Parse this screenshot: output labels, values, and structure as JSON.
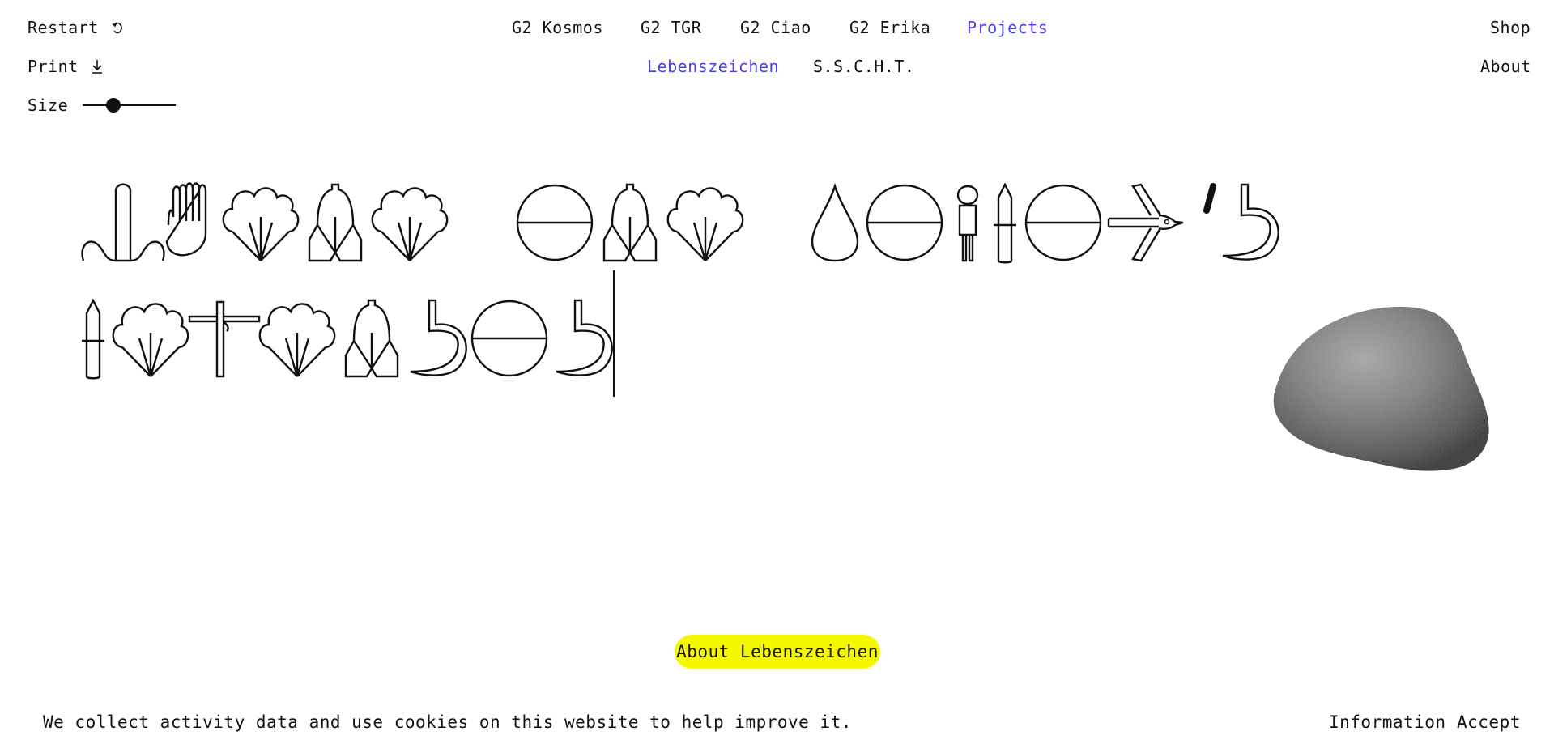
{
  "nav": {
    "restart_label": "Restart",
    "restart_icon": "restart-icon",
    "print_label": "Print",
    "print_icon": "download-arrow-icon",
    "size_label": "Size",
    "size_value": 0.3,
    "shop_label": "Shop",
    "about_label": "About",
    "fonts": [
      "G2 Kosmos",
      "G2 TGR",
      "G2 Ciao",
      "G2 Erika",
      "Projects"
    ],
    "active_font": "Projects",
    "projects": [
      "Lebenszeichen",
      "S.S.C.H.T."
    ],
    "active_project": "Lebenszeichen"
  },
  "typed_text": {
    "line1": [
      "nose",
      "hand",
      "tree",
      "bell",
      "tree",
      "space",
      "circle",
      "bell",
      "tree",
      "space",
      "drop",
      "circle",
      "person",
      "knife",
      "circle",
      "bird",
      "apostrophe",
      "sickle"
    ],
    "line2": [
      "knife",
      "tree",
      "cross",
      "tree",
      "bell",
      "sickle",
      "circle",
      "sickle"
    ]
  },
  "stone": {
    "icon": "stone-image"
  },
  "about_button": "About Lebenszeichen",
  "cookie": {
    "message": "We collect activity data and use cookies on this website to help improve it.",
    "info_label": "Information",
    "accept_label": "Accept"
  },
  "colors": {
    "accent": "#4a3fe0",
    "highlight": "#f6f800",
    "ink": "#111111",
    "background": "#ffffff"
  }
}
